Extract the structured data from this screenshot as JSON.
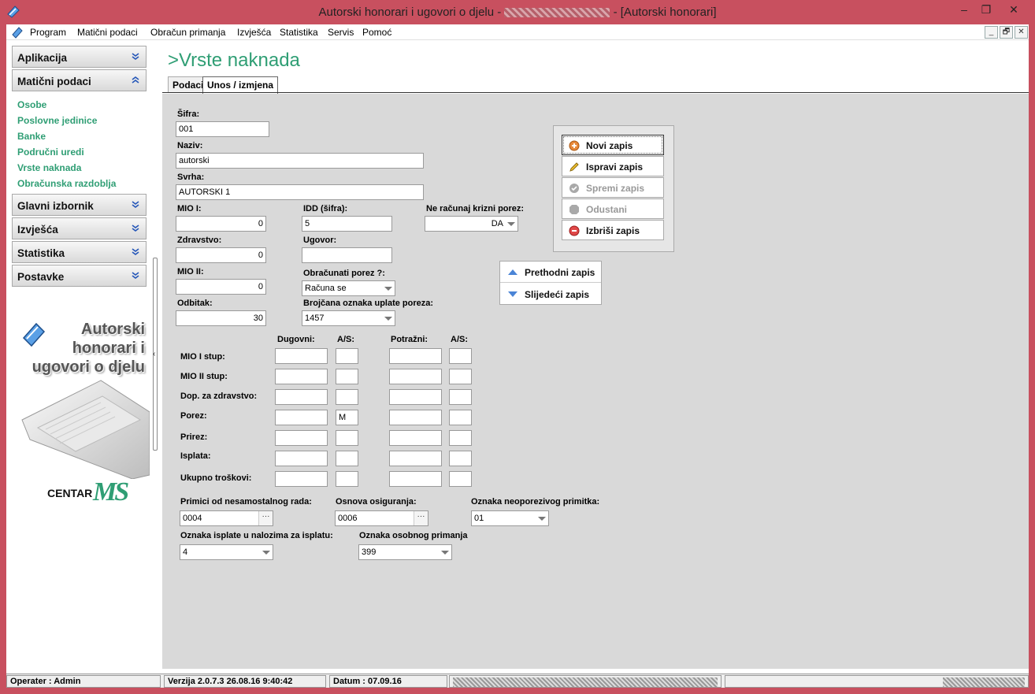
{
  "window": {
    "title_prefix": "Autorski honorari i ugovori o djelu - ",
    "title_suffix": " - [Autorski honorari]",
    "minimize": "–",
    "maximize": "❐",
    "close": "✕"
  },
  "menu": {
    "items": [
      "Program",
      "Matični podaci",
      "Obračun primanja",
      "Izvješća",
      "Statistika",
      "Servis",
      "Pomoć"
    ],
    "mdi_buttons": [
      "_",
      "🗗",
      "✕"
    ]
  },
  "sidebar": {
    "sections": [
      {
        "label": "Aplikacija",
        "expanded": false
      },
      {
        "label": "Matični podaci",
        "expanded": true
      },
      {
        "label": "Glavni izbornik",
        "expanded": false
      },
      {
        "label": "Izvješća",
        "expanded": false
      },
      {
        "label": "Statistika",
        "expanded": false
      },
      {
        "label": "Postavke",
        "expanded": false
      }
    ],
    "links": [
      "Osobe",
      "Poslovne jedinice",
      "Banke",
      "Područni uredi",
      "Vrste naknada",
      "Obračunska razdoblja"
    ],
    "promo_lines": [
      "Autorski",
      "honorari i",
      "ugovori o djelu"
    ],
    "logo_text": {
      "centar": "CENTAR",
      "ms": "MS"
    }
  },
  "main": {
    "title": ">Vrste naknada",
    "tabs": [
      {
        "label": "Podaci",
        "active": false
      },
      {
        "label": "Unos / izmjena",
        "active": true
      }
    ]
  },
  "form": {
    "sifra": {
      "label": "Šifra:",
      "value": "001"
    },
    "naziv": {
      "label": "Naziv:",
      "value": "autorski"
    },
    "svrha": {
      "label": "Svrha:",
      "value": "AUTORSKI 1"
    },
    "mio1": {
      "label": "MIO I:",
      "value": "0"
    },
    "zdravstvo": {
      "label": "Zdravstvo:",
      "value": "0"
    },
    "mio2": {
      "label": "MIO II:",
      "value": "0"
    },
    "odbitak": {
      "label": "Odbitak:",
      "value": "30"
    },
    "idd": {
      "label": "IDD (šifra):",
      "value": "5"
    },
    "ugovor": {
      "label": "Ugovor:",
      "value": ""
    },
    "obracunati_porez": {
      "label": "Obračunati porez ?:",
      "value": "Računa se"
    },
    "brojcana_oznaka": {
      "label": "Brojčana oznaka uplate poreza:",
      "value": "1457"
    },
    "krizni_porez": {
      "label": "Ne računaj krizni porez:",
      "value": "DA"
    },
    "grid": {
      "headers": {
        "dugovni": "Dugovni:",
        "as1": "A/S:",
        "potrazni": "Potražni:",
        "as2": "A/S:"
      },
      "rows": [
        {
          "label": "MIO I stup:",
          "dugovni": "",
          "as1": "",
          "potrazni": "",
          "as2": ""
        },
        {
          "label": "MIO II stup:",
          "dugovni": "",
          "as1": "",
          "potrazni": "",
          "as2": ""
        },
        {
          "label": "Dop. za zdravstvo:",
          "dugovni": "",
          "as1": "",
          "potrazni": "",
          "as2": ""
        },
        {
          "label": "Porez:",
          "dugovni": "",
          "as1": "M",
          "potrazni": "",
          "as2": ""
        },
        {
          "label": "Prirez:",
          "dugovni": "",
          "as1": "",
          "potrazni": "",
          "as2": ""
        },
        {
          "label": "Isplata:",
          "dugovni": "",
          "as1": "",
          "potrazni": "",
          "as2": ""
        },
        {
          "label": "Ukupno troškovi:",
          "dugovni": "",
          "as1": "",
          "potrazni": "",
          "as2": ""
        }
      ]
    },
    "primici": {
      "label": "Primici od nesamostalnog rada:",
      "value": "0004"
    },
    "osnova": {
      "label": "Osnova osiguranja:",
      "value": "0006"
    },
    "neoporezivi": {
      "label": "Oznaka neoporezivog primitka:",
      "value": "01"
    },
    "oznaka_isplate": {
      "label": "Oznaka isplate u nalozima za isplatu:",
      "value": "4"
    },
    "osobni_primanja": {
      "label": "Oznaka osobnog primanja",
      "value": "399"
    }
  },
  "actions": {
    "novi": "Novi zapis",
    "ispravi": "Ispravi zapis",
    "spremi": "Spremi zapis",
    "odustani": "Odustani",
    "izbrisi": "Izbriši zapis",
    "prethodni": "Prethodni zapis",
    "sljedeci": "Slijedeći zapis"
  },
  "status": {
    "operater": "Operater :  Admin",
    "verzija": "Verzija 2.0.7.3    26.08.16 9:40:42",
    "datum": "Datum  :  07.09.16"
  },
  "colors": {
    "accent": "#2f9e74",
    "titlebar": "#c8505f",
    "form_bg": "#d9d9d9"
  }
}
